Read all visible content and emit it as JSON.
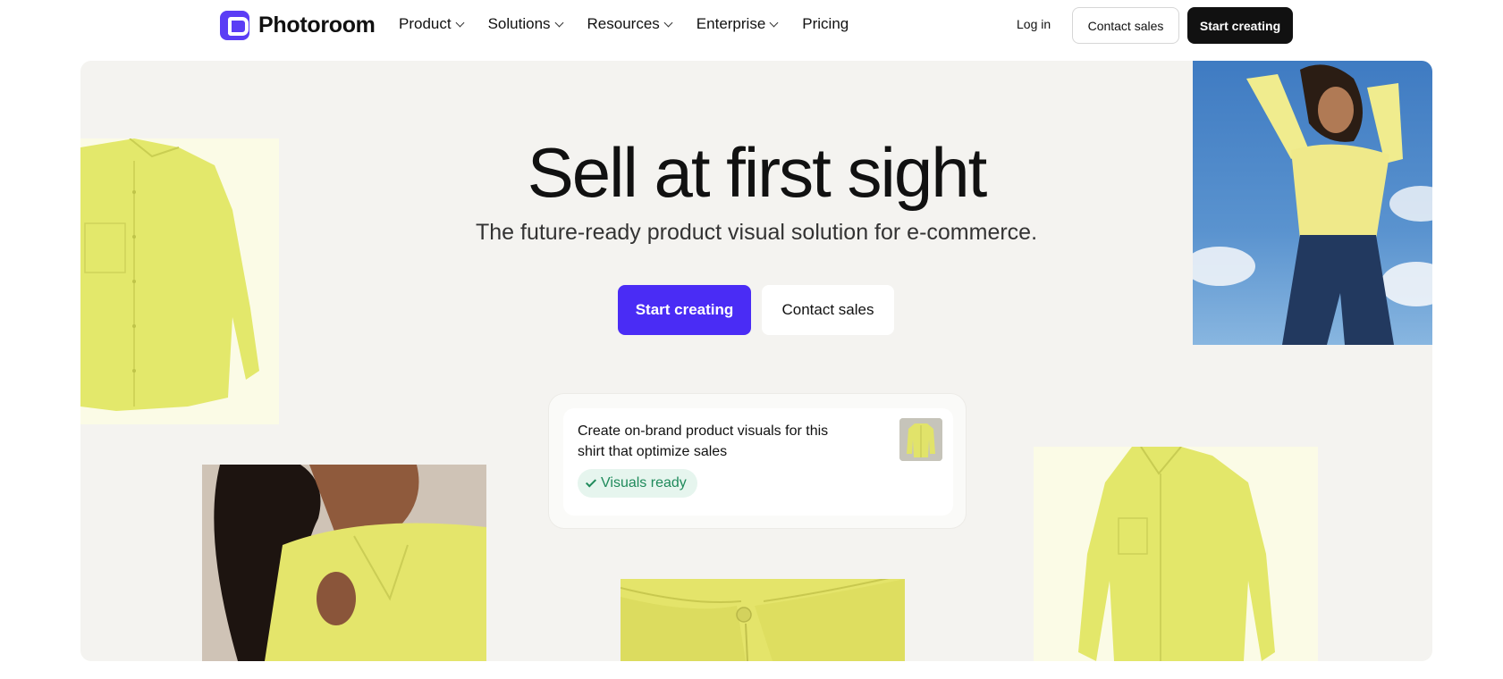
{
  "nav": {
    "logo_text": "Photoroom",
    "menu": [
      "Product",
      "Solutions",
      "Resources",
      "Enterprise",
      "Pricing"
    ],
    "login": "Log in",
    "contact_sales": "Contact sales",
    "start_creating": "Start creating"
  },
  "hero": {
    "title": "Sell at first sight",
    "subtitle": "The future-ready product visual solution for e-commerce.",
    "primary_cta": "Start creating",
    "secondary_cta": "Contact sales",
    "card": {
      "prompt": "Create on-brand product visuals for this shirt that optimize sales",
      "status": "Visuals ready"
    }
  },
  "colors": {
    "brand": "#5b3df5",
    "primary_button": "#4a2cf5",
    "hero_bg": "#f4f3f0",
    "shirt_yellow": "#e6ea6a",
    "status_green": "#1f8a5b"
  },
  "images": [
    "yellow-shirt-flatlay",
    "model-in-yellow-shirt-sky",
    "model-yellow-shirt-closeup",
    "shirt-collar-closeup",
    "yellow-shirt-ghost-mannequin"
  ]
}
